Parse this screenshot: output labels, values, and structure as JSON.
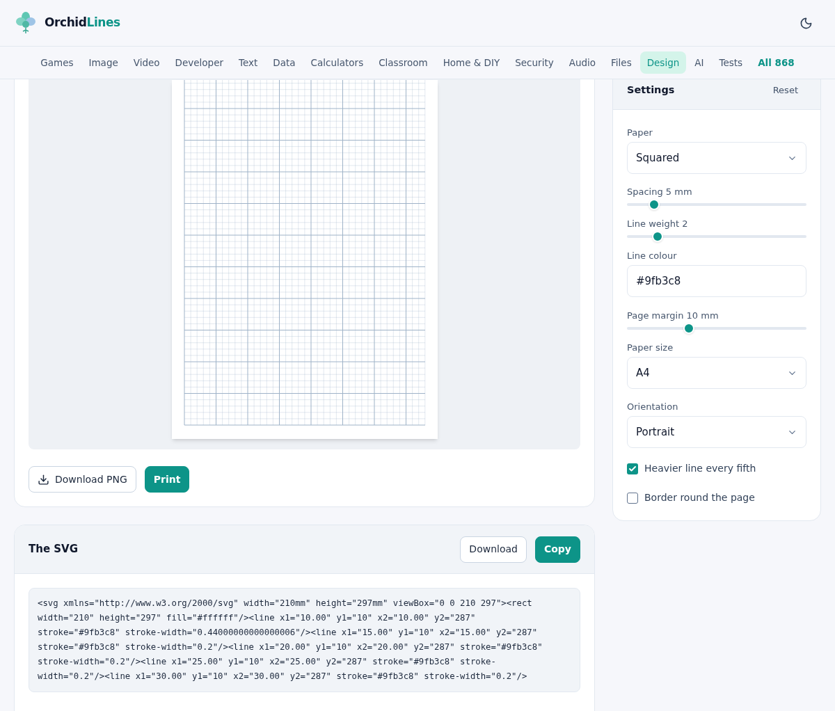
{
  "brand": {
    "part1": "Orchid",
    "part2": "Lines"
  },
  "nav": [
    {
      "label": "Games",
      "selected": false
    },
    {
      "label": "Image",
      "selected": false
    },
    {
      "label": "Video",
      "selected": false
    },
    {
      "label": "Developer",
      "selected": false
    },
    {
      "label": "Text",
      "selected": false
    },
    {
      "label": "Data",
      "selected": false
    },
    {
      "label": "Calculators",
      "selected": false
    },
    {
      "label": "Classroom",
      "selected": false
    },
    {
      "label": "Home & DIY",
      "selected": false
    },
    {
      "label": "Security",
      "selected": false
    },
    {
      "label": "Audio",
      "selected": false
    },
    {
      "label": "Files",
      "selected": false
    },
    {
      "label": "Design",
      "selected": true
    },
    {
      "label": "AI",
      "selected": false
    },
    {
      "label": "Tests",
      "selected": false
    }
  ],
  "nav_all": "All 868",
  "preview": {
    "buttons": [
      {
        "kind": "outline",
        "label": "Download PNG"
      },
      {
        "kind": "primary",
        "label": "Print"
      }
    ]
  },
  "svg_card": {
    "title": "The SVG",
    "buttons": [
      {
        "kind": "outline",
        "label": "Download"
      },
      {
        "kind": "primary",
        "label": "Copy"
      }
    ],
    "code_lines": [
      "<svg xmlns=\"http://www.w3.org/2000/svg\" width=\"210mm\" height=\"297mm\" viewBox=\"0 0 210 297\"><rect",
      "width=\"210\" height=\"297\" fill=\"#ffffff\"/><line x1=\"10.00\" y1=\"10\" x2=\"10.00\" y2=\"287\"",
      "stroke=\"#9fb3c8\" stroke-width=\"0.44000000000000006\"/><line x1=\"15.00\" y1=\"10\" x2=\"15.00\" y2=\"287\"",
      "stroke=\"#9fb3c8\" stroke-width=\"0.2\"/><line x1=\"20.00\" y1=\"10\" x2=\"20.00\" y2=\"287\" stroke=\"#9fb3c8\"",
      "stroke-width=\"0.2\"/><line x1=\"25.00\" y1=\"10\" x2=\"25.00\" y2=\"287\" stroke=\"#9fb3c8\" stroke-",
      "width=\"0.2\"/><line x1=\"30.00\" y1=\"10\" x2=\"30.00\" y2=\"287\" stroke=\"#9fb3c8\" stroke-width=\"0.2\"/>"
    ]
  },
  "settings": {
    "title": "Settings",
    "reset": "Reset",
    "fields": [
      {
        "kind": "select",
        "label": "Paper",
        "value": "Squared"
      },
      {
        "kind": "slider",
        "label": "Spacing 5 mm",
        "level": 0.15
      },
      {
        "kind": "slider",
        "label": "Line weight 2",
        "level": 0.17
      },
      {
        "kind": "text",
        "label": "Line colour",
        "value": "#9fb3c8"
      },
      {
        "kind": "slider",
        "label": "Page margin 10 mm",
        "level": 0.345
      },
      {
        "kind": "select",
        "label": "Paper size",
        "value": "A4"
      },
      {
        "kind": "select",
        "label": "Orientation",
        "value": "Portrait"
      },
      {
        "kind": "checkbox",
        "label": "Heavier line every fifth",
        "checked": true
      },
      {
        "kind": "checkbox",
        "label": "Border round the page",
        "checked": false
      }
    ]
  }
}
